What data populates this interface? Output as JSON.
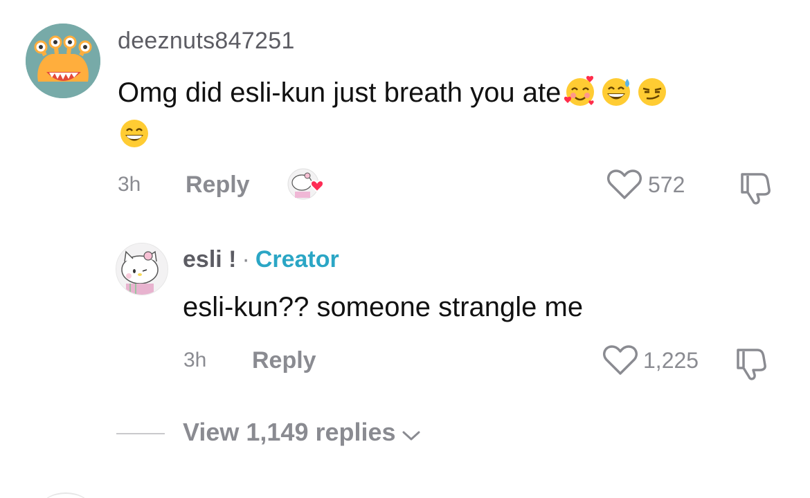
{
  "comment": {
    "username": "deeznuts847251",
    "text": "Omg did esli-kun just breath you ate",
    "emojis": [
      "smiling-face-with-hearts",
      "grinning-face-with-sweat",
      "smirking-face",
      "beaming-face"
    ],
    "time": "3h",
    "reply_label": "Reply",
    "likes": "572"
  },
  "reply": {
    "username": "esli !",
    "separator": "·",
    "badge": "Creator",
    "text": "esli-kun?? someone strangle me",
    "time": "3h",
    "reply_label": "Reply",
    "likes": "1,225"
  },
  "thread": {
    "view_replies": "View 1,149 replies"
  },
  "colors": {
    "creator_badge": "#2ba6c5",
    "liked_heart": "#fe2c55",
    "muted_text": "#8a8b91"
  }
}
